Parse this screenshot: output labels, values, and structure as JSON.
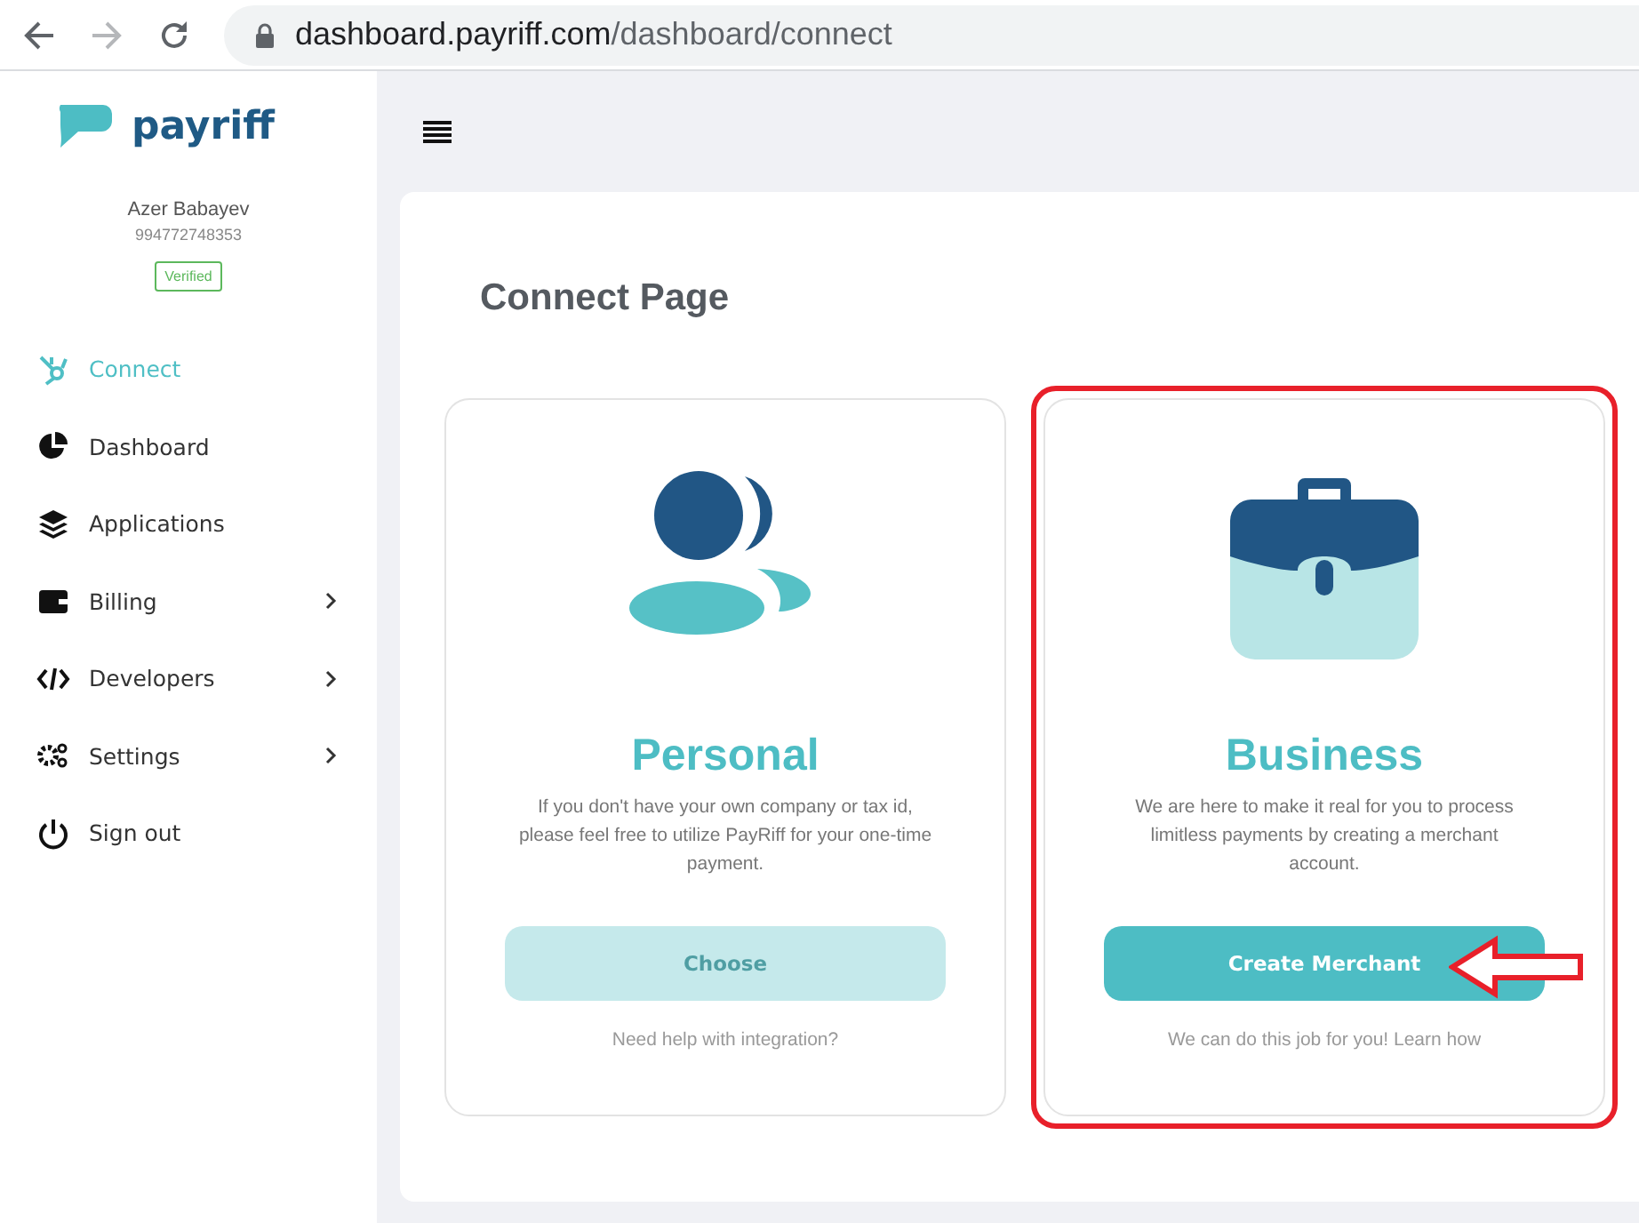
{
  "browser": {
    "url_host": "dashboard.payriff.com",
    "url_path": "/dashboard/connect"
  },
  "brand": "payriff",
  "user": {
    "name": "Azer Babayev",
    "phone": "994772748353",
    "badge": "Verified"
  },
  "sidebar": {
    "items": [
      {
        "label": "Connect",
        "selected": true,
        "has_submenu": false
      },
      {
        "label": "Dashboard",
        "selected": false,
        "has_submenu": false
      },
      {
        "label": "Applications",
        "selected": false,
        "has_submenu": false
      },
      {
        "label": "Billing",
        "selected": false,
        "has_submenu": true
      },
      {
        "label": "Developers",
        "selected": false,
        "has_submenu": true
      },
      {
        "label": "Settings",
        "selected": false,
        "has_submenu": true
      },
      {
        "label": "Sign out",
        "selected": false,
        "has_submenu": false
      }
    ]
  },
  "page": {
    "title": "Connect Page",
    "cards": [
      {
        "kind": "personal",
        "title": "Personal",
        "description": "If you don't have your own company or tax id, please feel free to utilize PayRiff for your one-time payment.",
        "button": "Choose",
        "disabled": true,
        "highlighted": false,
        "footer": "Need help with integration?"
      },
      {
        "kind": "business",
        "title": "Business",
        "description": "We are here to make it real for you to process limitless payments by creating a merchant account.",
        "button": "Create Merchant",
        "disabled": false,
        "highlighted": true,
        "footer": "We can do this job for you! Learn how"
      }
    ]
  }
}
